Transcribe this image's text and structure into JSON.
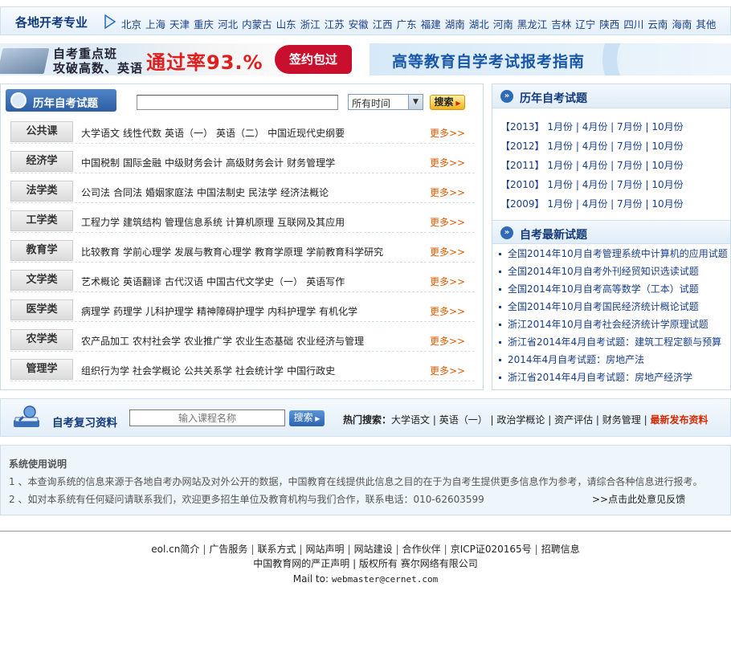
{
  "regions": {
    "title": "各地开考专业",
    "items": [
      "北京",
      "上海",
      "天津",
      "重庆",
      "河北",
      "内蒙古",
      "山东",
      "浙江",
      "江苏",
      "安徽",
      "江西",
      "广东",
      "福建",
      "湖南",
      "湖北",
      "河南",
      "黑龙江",
      "吉林",
      "辽宁",
      "陕西",
      "四川",
      "云南",
      "海南",
      "其他"
    ]
  },
  "banners": {
    "left": {
      "line1": "自考重点班",
      "line2": "攻破高数、英语",
      "pass": "通过率93.%",
      "seal": "签约包过"
    },
    "right": {
      "text": "高等教育自学考试报考指南"
    }
  },
  "exam_panel": {
    "title": "历年自考试题",
    "search_value": "",
    "time_select": "所有时间",
    "search_button": "搜索",
    "more_label": "更多>>",
    "categories": [
      {
        "label": "公共课",
        "subjects": [
          "大学语文",
          "线性代数",
          "英语（一）",
          "英语（二）",
          "中国近现代史纲要"
        ]
      },
      {
        "label": "经济学",
        "subjects": [
          "中国税制",
          "国际金融",
          "中级财务会计",
          "高级财务会计",
          "财务管理学"
        ]
      },
      {
        "label": "法学类",
        "subjects": [
          "公司法",
          "合同法",
          "婚姻家庭法",
          "中国法制史",
          "民法学",
          "经济法概论"
        ]
      },
      {
        "label": "工学类",
        "subjects": [
          "工程力学",
          "建筑结构",
          "管理信息系统",
          "计算机原理",
          "互联网及其应用"
        ]
      },
      {
        "label": "教育学",
        "subjects": [
          "比较教育",
          "学前心理学",
          "发展与教育心理学",
          "教育学原理",
          "学前教育科学研究"
        ]
      },
      {
        "label": "文学类",
        "subjects": [
          "艺术概论",
          "英语翻译",
          "古代汉语",
          "中国古代文学史（一）",
          "英语写作"
        ]
      },
      {
        "label": "医学类",
        "subjects": [
          "病理学",
          "药理学",
          "儿科护理学",
          "精神障碍护理学",
          "内科护理学",
          "有机化学"
        ]
      },
      {
        "label": "农学类",
        "subjects": [
          "农产品加工",
          "农村社会学",
          "农业推广学",
          "农业生态基础",
          "农业经济与管理"
        ]
      },
      {
        "label": "管理学",
        "subjects": [
          "组织行为学",
          "社会学概论",
          "公共关系学",
          "社会统计学",
          "中国行政史"
        ]
      }
    ]
  },
  "side": {
    "past_title": "历年自考试题",
    "years": [
      {
        "year": "【2013】",
        "months": [
          "1月份",
          "4月份",
          "7月份",
          "10月份"
        ]
      },
      {
        "year": "【2012】",
        "months": [
          "1月份",
          "4月份",
          "7月份",
          "10月份"
        ]
      },
      {
        "year": "【2011】",
        "months": [
          "1月份",
          "4月份",
          "7月份",
          "10月份"
        ]
      },
      {
        "year": "【2010】",
        "months": [
          "1月份",
          "4月份",
          "7月份",
          "10月份"
        ]
      },
      {
        "year": "【2009】",
        "months": [
          "1月份",
          "4月份",
          "7月份",
          "10月份"
        ]
      }
    ],
    "latest_title": "自考最新试题",
    "latest": [
      "全国2014年10月自考管理系统中计算机的应用试题",
      "全国2014年10月自考外刊经贸知识选读试题",
      "全国2014年10月自考高等数学（工本）试题",
      "全国2014年10月自考国民经济统计概论试题",
      "浙江2014年10月自考社会经济统计学原理试题",
      "浙江省2014年4月自考试题：建筑工程定额与预算",
      "2014年4月自考试题：房地产法",
      "浙江省2014年4月自考试题：房地产经济学"
    ]
  },
  "review": {
    "title": "自考复习资料",
    "placeholder": "输入课程名称",
    "button": "搜索",
    "hot_label": "热门搜索：",
    "hot_items": [
      "大学语文",
      "英语（一）",
      "政治学概论",
      "资产评估",
      "财务管理"
    ],
    "latest_link": "最新发布资料"
  },
  "notice": {
    "title": "系统使用说明",
    "line1": "1 、本查询系统的信息来源于各地自考办网站及对外公开的数据，中国教育在线提供此信息之目的在于为自考生提供更多信息作为参考，请综合各种信息进行报考。",
    "line2": "2 、如对本系统有任何疑问请联系我们，欢迎更多招生单位及教育机构与我们合作，联系电话：010-62603599",
    "feedback": ">>点击此处意见反馈"
  },
  "footer": {
    "links": [
      "eol.cn简介",
      "广告服务",
      "联系方式",
      "网站声明",
      "网站建设",
      "合作伙伴",
      "京ICP证020165号",
      "招聘信息"
    ],
    "copy": "中国教育网的严正声明 | 版权所有 赛尔网络有限公司",
    "mail_label": "Mail to: ",
    "mail_addr": "webmaster@cernet.com"
  },
  "colors": {
    "brand": "#123a7a",
    "link": "#1a3f8a",
    "more": "#e05a00",
    "accent_red": "#d52a00"
  }
}
